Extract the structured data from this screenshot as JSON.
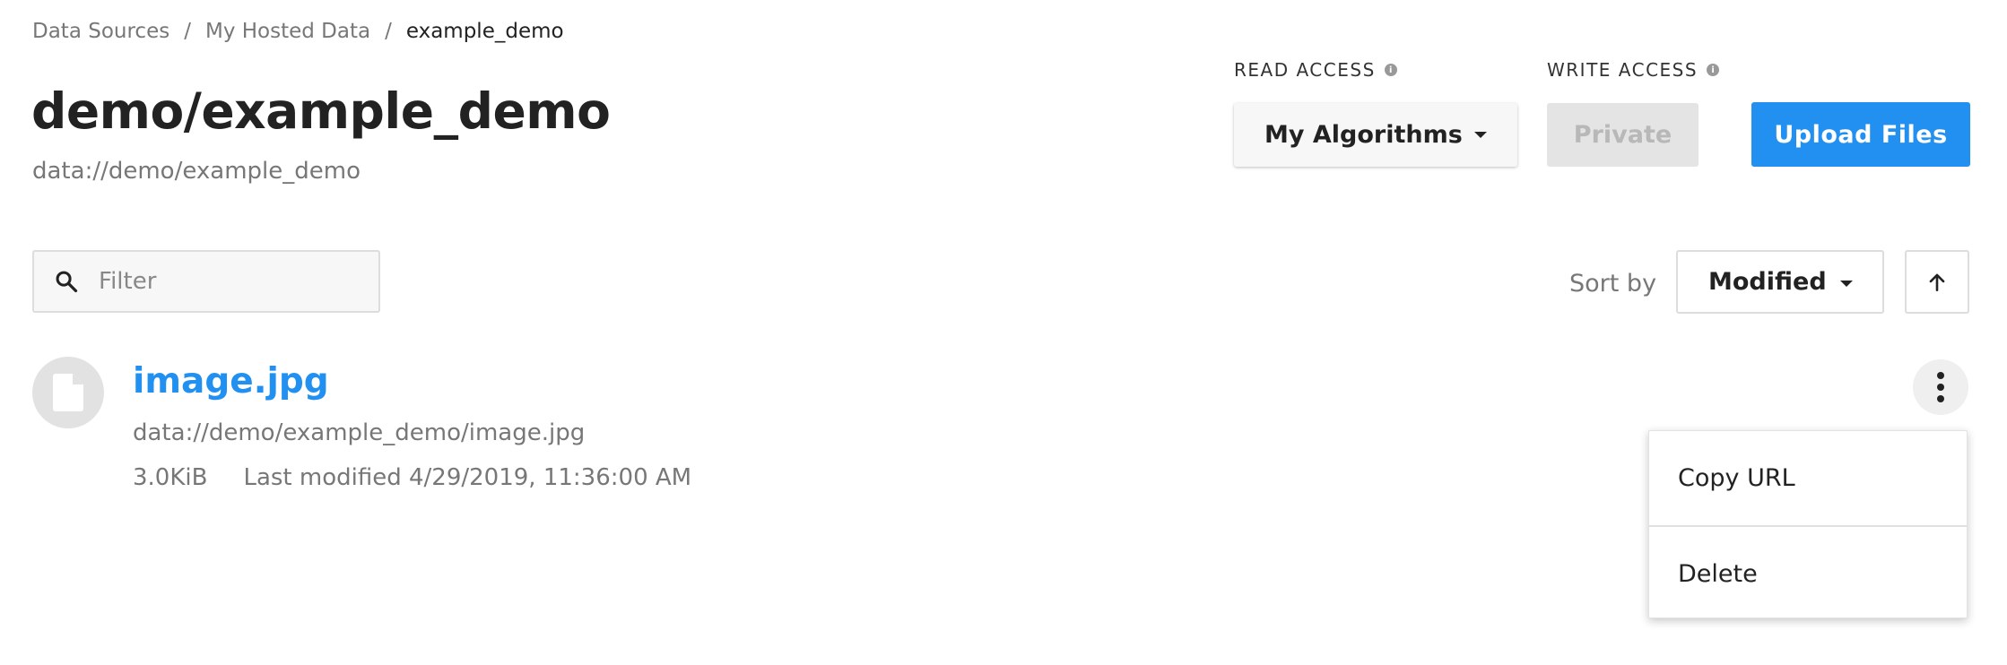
{
  "breadcrumb": {
    "items": [
      "Data Sources",
      "My Hosted Data"
    ],
    "separator": "/",
    "current": "example_demo"
  },
  "header": {
    "title": "demo/example_demo",
    "subtitle": "data://demo/example_demo"
  },
  "access": {
    "read_label": "READ ACCESS",
    "read_value": "My Algorithms",
    "write_label": "WRITE ACCESS",
    "write_value": "Private",
    "info_glyph": "i"
  },
  "actions": {
    "upload_label": "Upload Files"
  },
  "filter": {
    "placeholder": "Filter",
    "value": ""
  },
  "sort": {
    "label": "Sort by",
    "value": "Modified",
    "direction_icon": "arrow-up-icon"
  },
  "files": [
    {
      "name": "image.jpg",
      "path": "data://demo/example_demo/image.jpg",
      "size": "3.0KiB",
      "modified": "Last modified 4/29/2019, 11:36:00 AM",
      "icon": "file-icon"
    }
  ],
  "context_menu": {
    "items": [
      "Copy URL",
      "Delete"
    ]
  },
  "colors": {
    "accent": "#2190f0",
    "disabled_bg": "#e4e4e4",
    "muted_text": "#777777"
  }
}
